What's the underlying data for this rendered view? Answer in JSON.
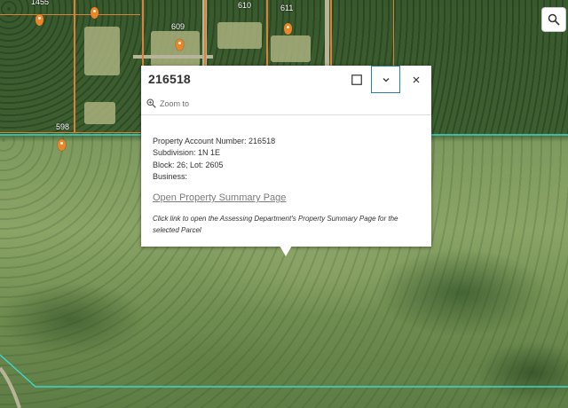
{
  "map": {
    "parcel_labels": [
      "1455",
      "609",
      "610",
      "611",
      "598"
    ],
    "colors": {
      "parcel_lines": "#d9823b",
      "selection_outline": "#3fd6c8",
      "pins": "#e8872a"
    }
  },
  "toolbar": {
    "search_icon": "search-icon"
  },
  "popup": {
    "title": "216518",
    "dock_icon": "dock-icon",
    "collapse_icon": "chevron-down-icon",
    "close_icon": "close-icon",
    "zoom_to_label": "Zoom to",
    "attributes": [
      "Property Account Number: 216518",
      "Subdivision: 1N 1E",
      "Block: 26;  Lot:  2605",
      "Business:"
    ],
    "summary_link": "Open Property Summary Page",
    "note": "Click link to open the Assessing Department's Property Summary Page for the selected Parcel"
  }
}
